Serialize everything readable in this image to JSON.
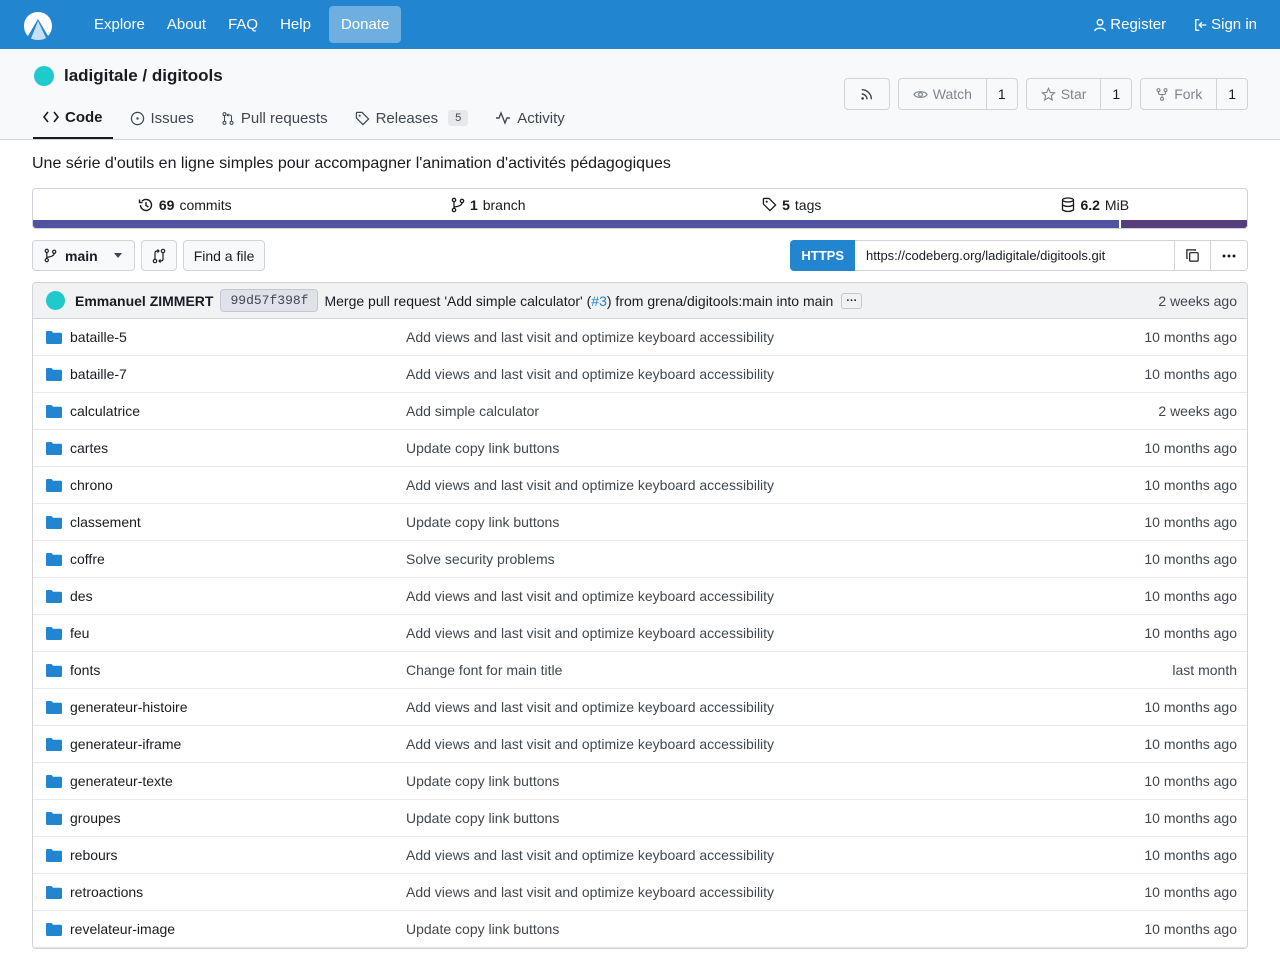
{
  "nav": {
    "items": [
      "Explore",
      "About",
      "FAQ",
      "Help"
    ],
    "donate": "Donate",
    "register": "Register",
    "signin": "Sign in"
  },
  "repo": {
    "title": "ladigitale / digitools",
    "description": "Une série d'outils en ligne simples pour accompagner l'animation d'activités pédagogiques",
    "watch_label": "Watch",
    "watch_count": "1",
    "star_label": "Star",
    "star_count": "1",
    "fork_label": "Fork",
    "fork_count": "1",
    "tabs": [
      {
        "label": "Code",
        "icon": "code-icon"
      },
      {
        "label": "Issues",
        "icon": "issue-icon"
      },
      {
        "label": "Pull requests",
        "icon": "pull-request-icon"
      },
      {
        "label": "Releases",
        "icon": "tag-icon",
        "badge": "5"
      },
      {
        "label": "Activity",
        "icon": "pulse-icon"
      }
    ]
  },
  "stats": {
    "commits_n": "69",
    "commits_label": "commits",
    "branch_n": "1",
    "branch_label": "branch",
    "tags_n": "5",
    "tags_label": "tags",
    "size_n": "6.2",
    "size_unit": "MiB",
    "lang_colors": [
      "#563d7c",
      "#5054a0"
    ]
  },
  "toolbar": {
    "branch": "main",
    "find_file": "Find a file",
    "https": "HTTPS",
    "clone_url": "https://codeberg.org/ladigitale/digitools.git"
  },
  "latest_commit": {
    "author": "Emmanuel ZIMMERT",
    "sha": "99d57f398f",
    "message_pre": "Merge pull request 'Add simple calculator' (",
    "pr": "#3",
    "message_post": ") from grena/digitools:main into main",
    "time": "2 weeks ago"
  },
  "files": [
    {
      "name": "bataille-5",
      "msg": "Add views and last visit and optimize keyboard accessibility",
      "time": "10 months ago"
    },
    {
      "name": "bataille-7",
      "msg": "Add views and last visit and optimize keyboard accessibility",
      "time": "10 months ago"
    },
    {
      "name": "calculatrice",
      "msg": "Add simple calculator",
      "time": "2 weeks ago"
    },
    {
      "name": "cartes",
      "msg": "Update copy link buttons",
      "time": "10 months ago"
    },
    {
      "name": "chrono",
      "msg": "Add views and last visit and optimize keyboard accessibility",
      "time": "10 months ago"
    },
    {
      "name": "classement",
      "msg": "Update copy link buttons",
      "time": "10 months ago"
    },
    {
      "name": "coffre",
      "msg": "Solve security problems",
      "time": "10 months ago"
    },
    {
      "name": "des",
      "msg": "Add views and last visit and optimize keyboard accessibility",
      "time": "10 months ago"
    },
    {
      "name": "feu",
      "msg": "Add views and last visit and optimize keyboard accessibility",
      "time": "10 months ago"
    },
    {
      "name": "fonts",
      "msg": "Change font for main title",
      "time": "last month"
    },
    {
      "name": "generateur-histoire",
      "msg": "Add views and last visit and optimize keyboard accessibility",
      "time": "10 months ago"
    },
    {
      "name": "generateur-iframe",
      "msg": "Add views and last visit and optimize keyboard accessibility",
      "time": "10 months ago"
    },
    {
      "name": "generateur-texte",
      "msg": "Update copy link buttons",
      "time": "10 months ago"
    },
    {
      "name": "groupes",
      "msg": "Update copy link buttons",
      "time": "10 months ago"
    },
    {
      "name": "rebours",
      "msg": "Add views and last visit and optimize keyboard accessibility",
      "time": "10 months ago"
    },
    {
      "name": "retroactions",
      "msg": "Add views and last visit and optimize keyboard accessibility",
      "time": "10 months ago"
    },
    {
      "name": "revelateur-image",
      "msg": "Update copy link buttons",
      "time": "10 months ago"
    }
  ]
}
